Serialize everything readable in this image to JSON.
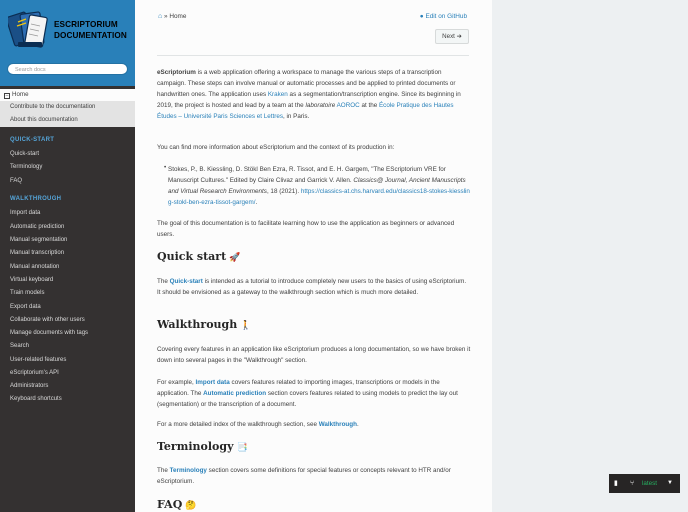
{
  "sidebar": {
    "brand_line1": "ESCRIPTORIUM",
    "brand_line2": "DOCUMENTATION",
    "search_placeholder": "Search docs",
    "home": "Home",
    "home_sub": [
      "Contribute to the documentation",
      "About this documentation"
    ],
    "quickstart_caption": "QUICK-START",
    "quickstart_items": [
      "Quick-start",
      "Terminology",
      "FAQ"
    ],
    "walkthrough_caption": "WALKTHROUGH",
    "walkthrough_items": [
      "Import data",
      "Automatic prediction",
      "Manual segmentation",
      "Manual transcription",
      "Manual annotation",
      "Virtual keyboard",
      "Train models",
      "Export data",
      "Collaborate with other users",
      "Manage documents with tags",
      "Search",
      "User-related features",
      "eScriptorium's API",
      "Administrators",
      "Keyboard shortcuts"
    ]
  },
  "header": {
    "breadcrumb_sep": "»",
    "breadcrumb_home": "Home",
    "edit_link": "Edit on GitHub",
    "next_button": "Next"
  },
  "intro": {
    "brand": "eScriptorium",
    "p1a": " is a web application offering a workspace to manage the various steps of a transcription campaign. These steps can involve manual or automatic processes and be applied to printed documents or handwritten ones. The application uses ",
    "kraken": "Kraken",
    "p1b": " as a segmentation/transcription engine. Since its beginning in 2019, the project is hosted and lead by a team at the ",
    "lab": "laboratoire",
    "aoroc": "AOROC",
    "p1c": " at the ",
    "ephe": "École Pratique des Hautes Études – Université Paris Sciences et Lettres",
    "p1d": ", in Paris.",
    "p2": "You can find more information about eScriptorium and the context of its production in:",
    "cite_a": "Stokes, P., B. Kiessling, D. Stökl Ben Ezra, R. Tissot, and E. H. Gargem, \"The EScriptorium VRE for Manuscript Cultures.\" Edited by Claire Clivaz and Garrick V. Allen. ",
    "cite_journal": "Classics@ Journal, Ancient Manuscripts and Virtual Research Environments",
    "cite_b": ", 18 (2021). ",
    "cite_url": "https://classics-at.chs.harvard.edu/classics18-stokes-kiessling-stokl-ben-ezra-tissot-gargem/",
    "cite_end": ".",
    "p3": "The goal of this documentation is to facilitate learning how to use the application as beginners or advanced users."
  },
  "quickstart": {
    "heading": "Quick start",
    "emoji": "🚀",
    "pre": "The ",
    "link": "Quick-start",
    "post": " is intended as a tutorial to introduce completely new users to the basics of using eScriptorium. It should be envisioned as a gateway to the walkthrough section which is much more detailed."
  },
  "walkthrough": {
    "heading": "Walkthrough",
    "emoji": "🚶",
    "p1": "Covering every features in an application like eScriptorium produces a long documentation, so we have broken it down into several pages in the \"Walkthrough\" section.",
    "p2_pre": "For example, ",
    "p2_link1": "Import data",
    "p2_mid": " covers features related to importing images, transcriptions or models in the application. The ",
    "p2_link2": "Automatic prediction",
    "p2_post": " section covers features related to using models to predict the lay out (segmentation) or the transcription of a document.",
    "p3_pre": "For a more detailed index of the walkthrough section, see ",
    "p3_link": "Walkthrough",
    "p3_post": "."
  },
  "terminology": {
    "heading": "Terminology",
    "emoji": "📑",
    "pre": "The ",
    "link": "Terminology",
    "post": " section covers some definitions for special features or concepts relevant to HTR and/or eScriptorium."
  },
  "faq": {
    "heading": "FAQ",
    "emoji": "🤔"
  },
  "version_badge": {
    "version": "latest"
  }
}
